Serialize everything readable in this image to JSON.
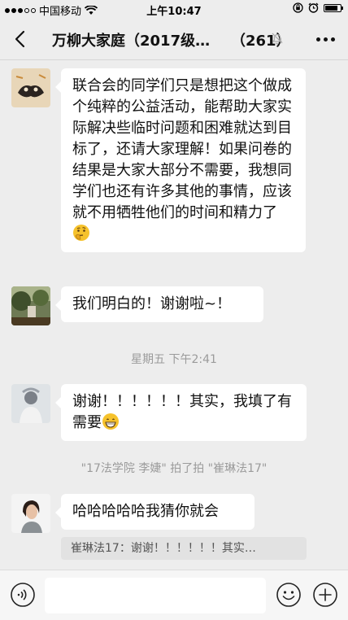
{
  "status_bar": {
    "carrier": "中国移动",
    "time": "上午10:47",
    "battery_level": 0.85
  },
  "nav": {
    "title": "万柳大家庭（2017级…",
    "member_count": "（261）"
  },
  "messages": [
    {
      "text": "联合会的同学们只是想把这个做成个纯粹的公益活动，能帮助大家实际解决些临时问题和困难就达到目标了，还请大家理解！如果问卷的结果是大家大部分不需要，我想同学们也还有许多其他的事情，应该就不用牺牲他们的时间和精力了",
      "emoji": "thinking-face"
    },
    {
      "text": "我们明白的！谢谢啦~！"
    },
    {
      "text": "谢谢！！！！！！其实，我填了有需要",
      "emoji": "grinning-face"
    },
    {
      "text": "哈哈哈哈哈我猜你就会"
    }
  ],
  "timestamp": "星期五 下午2:41",
  "system_message": "\"17法学院 李婕\" 拍了拍 \"崔琳法17\"",
  "quote": "崔琳法17：谢谢！！！！！！其实…",
  "colors": {
    "background": "#ededed",
    "bubble": "#ffffff",
    "emoji_yellow": "#f6c22c"
  }
}
